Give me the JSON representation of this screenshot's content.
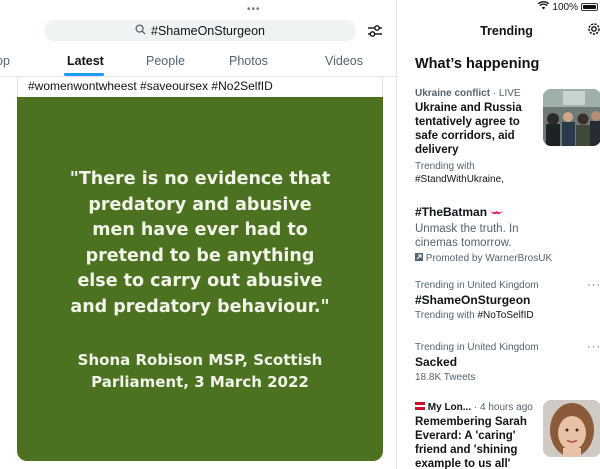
{
  "status": {
    "battery": "100%"
  },
  "search": {
    "query": "#ShameOnSturgeon"
  },
  "tabs": [
    {
      "label": "op"
    },
    {
      "label": "Latest"
    },
    {
      "label": "People"
    },
    {
      "label": "Photos"
    },
    {
      "label": "Videos"
    }
  ],
  "tweet": {
    "hashtags": "#womenwontwheest #saveoursex  #No2SelfID",
    "quote_lines": [
      "\"There is no evidence that",
      "predatory and abusive",
      "men have ever had to",
      "pretend to be anything",
      "else to carry out abusive",
      "and predatory behaviour.\""
    ],
    "attribution_lines": [
      "Shona Robison MSP, Scottish",
      "Parliament, 3 March 2022"
    ],
    "card_color": "#4b7121"
  },
  "sidebar": {
    "header": "Trending",
    "section_title": "What’s happening",
    "trends": [
      {
        "meta_bold": "Ukraine conflict",
        "meta": " · LIVE",
        "title_lines": [
          "Ukraine and Russia",
          "tentatively agree to",
          "safe corridors, aid",
          "delivery"
        ],
        "extra_lines": [
          "Trending with",
          "#StandWithUkraine,"
        ]
      },
      {
        "title": "#TheBatman",
        "desc_lines": [
          "Unmask the truth. In",
          "cinemas tomorrow."
        ],
        "promoted": "Promoted by WarnerBrosUK"
      },
      {
        "meta": "Trending in United Kingdom",
        "title": "#ShameOnSturgeon",
        "with_label": "Trending with ",
        "with_tag": "#NoToSelfID"
      },
      {
        "meta": "Trending in United Kingdom",
        "title": "Sacked",
        "count": "18.8K Tweets"
      },
      {
        "source": "My Lon...",
        "time": " · 4 hours ago",
        "title_lines": [
          "Remembering Sarah",
          "Everard: A 'caring'",
          "friend and 'shining",
          "example to us all'"
        ]
      }
    ]
  },
  "colors": {
    "accent": "#1d9bf0",
    "text": "#0f1419",
    "muted": "#536471"
  }
}
